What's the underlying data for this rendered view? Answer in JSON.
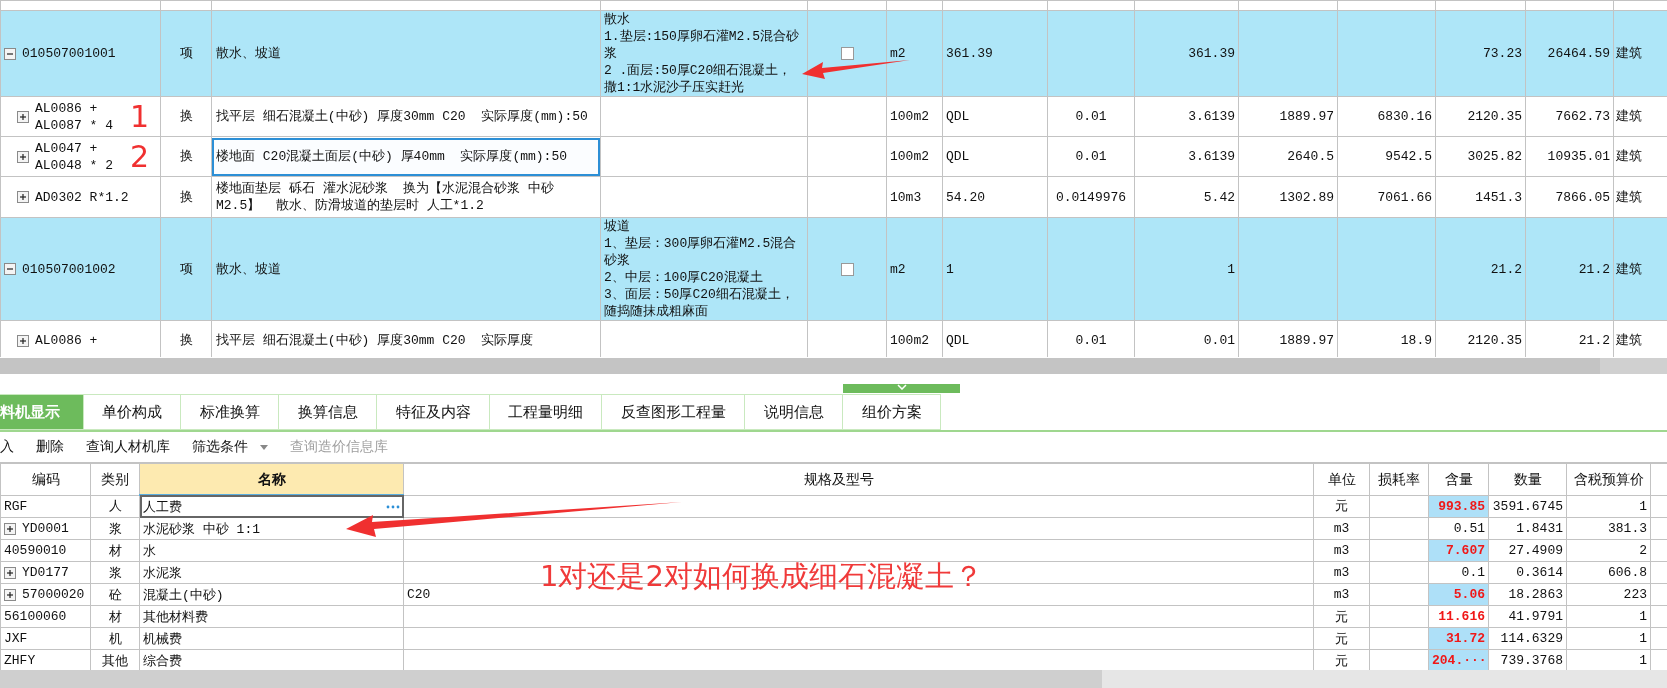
{
  "upper_table": {
    "rows": [
      {
        "kind": "item",
        "expanded": true,
        "selected": false,
        "checked": false,
        "code": "010507001001",
        "type": "项",
        "name": "散水、坡道",
        "features": "散水\n1.垫层:150厚卵石灌M2.5混合砂浆\n2 .面层:50厚C20细石混凝土，撒1:1水泥沙子压实赶光",
        "column_6": "m2",
        "column_7": "361.39",
        "column_9": "361.39",
        "column_12": "73.23",
        "column_13": "26464.59",
        "column_14": "建筑"
      },
      {
        "kind": "sub",
        "expanded": false,
        "selected": false,
        "code": "AL0086 +\nAL0087 * 4",
        "type": "换",
        "name": "找平层 细石混凝土(中砂) 厚度30mm C20  实际厚度(mm):50",
        "column_6": "100m2",
        "column_7": "QDL",
        "column_8": "0.01",
        "column_9": "3.6139",
        "column_10": "1889.97",
        "column_11": "6830.16",
        "column_12": "2120.35",
        "column_13": "7662.73",
        "column_14": "建筑"
      },
      {
        "kind": "sub",
        "expanded": false,
        "selected": true,
        "code": "AL0047 +\nAL0048 * 2",
        "type": "换",
        "name": "楼地面 C20混凝土面层(中砂) 厚40mm  实际厚度(mm):50",
        "column_6": "100m2",
        "column_7": "QDL",
        "column_8": "0.01",
        "column_9": "3.6139",
        "column_10": "2640.5",
        "column_11": "9542.5",
        "column_12": "3025.82",
        "column_13": "10935.01",
        "column_14": "建筑"
      },
      {
        "kind": "sub",
        "expanded": false,
        "selected": false,
        "code": "AD0302 R*1.2",
        "type": "换",
        "name": "楼地面垫层 砾石 灌水泥砂浆  换为【水泥混合砂浆 中砂 M2.5】  散水、防滑坡道的垫层时 人工*1.2",
        "column_6": "10m3",
        "column_7": "54.20",
        "column_8": "0.0149976",
        "column_9": "5.42",
        "column_10": "1302.89",
        "column_11": "7061.66",
        "column_12": "1451.3",
        "column_13": "7866.05",
        "column_14": "建筑"
      },
      {
        "kind": "item",
        "expanded": true,
        "selected": false,
        "checked": false,
        "code": "010507001002",
        "type": "项",
        "name": "散水、坡道",
        "features": "坡道\n1、垫层：300厚卵石灌M2.5混合砂浆\n2、中层：100厚C20混凝土\n3、面层：50厚C20细石混凝土，随捣随抹成粗麻面",
        "column_6": "m2",
        "column_7": "1",
        "column_9": "1",
        "column_12": "21.2",
        "column_13": "21.2",
        "column_14": "建筑"
      },
      {
        "kind": "sub",
        "expanded": false,
        "selected": false,
        "code": "AL0086 +",
        "type": "换",
        "name": "找平层 细石混凝土(中砂) 厚度30mm C20  实际厚度",
        "column_6": "100m2",
        "column_7": "QDL",
        "column_8": "0.01",
        "column_9": "0.01",
        "column_10": "1889.97",
        "column_11": "18.9",
        "column_12": "2120.35",
        "column_13": "21.2",
        "column_14": "建筑"
      }
    ]
  },
  "detail_tabs": [
    {
      "label": "料机显示",
      "selected": true
    },
    {
      "label": "单价构成",
      "selected": false
    },
    {
      "label": "标准换算",
      "selected": false
    },
    {
      "label": "换算信息",
      "selected": false
    },
    {
      "label": "特征及内容",
      "selected": false
    },
    {
      "label": "工程量明细",
      "selected": false
    },
    {
      "label": "反查图形工程量",
      "selected": false
    },
    {
      "label": "说明信息",
      "selected": false
    },
    {
      "label": "组价方案",
      "selected": false
    }
  ],
  "toolbar": [
    {
      "kind": "button",
      "label": "入",
      "disabled": false
    },
    {
      "kind": "button",
      "label": "删除",
      "disabled": false
    },
    {
      "kind": "button",
      "label": "查询人材机库",
      "disabled": false
    },
    {
      "kind": "dropdown",
      "label": "筛选条件",
      "disabled": false
    },
    {
      "kind": "button",
      "label": "查询造价信息库",
      "disabled": true
    }
  ],
  "material_table": {
    "columns": [
      {
        "label": "编码",
        "selected": false
      },
      {
        "label": "类别",
        "selected": false
      },
      {
        "label": "名称",
        "selected": true
      },
      {
        "label": "规格及型号",
        "selected": false
      },
      {
        "label": "单位",
        "selected": false
      },
      {
        "label": "损耗率",
        "selected": false
      },
      {
        "label": "含量",
        "selected": false
      },
      {
        "label": "数量",
        "selected": false
      },
      {
        "label": "含税预算价",
        "selected": false
      }
    ],
    "rows": [
      {
        "kind": "leaf",
        "selected": true,
        "code": "RGF",
        "type": "人",
        "name": "人工费",
        "unit": "元",
        "amount": "993.85",
        "modified": true,
        "highlighted": true,
        "quantity": "3591.6745",
        "price": "1"
      },
      {
        "kind": "group",
        "expanded": false,
        "selected": false,
        "code": "YD0001",
        "type": "浆",
        "name": "水泥砂浆 中砂 1:1",
        "unit": "m3",
        "amount": "0.51",
        "modified": false,
        "highlighted": false,
        "quantity": "1.8431",
        "price": "381.3"
      },
      {
        "kind": "leaf",
        "selected": false,
        "code": "40590010",
        "type": "材",
        "name": "水",
        "unit": "m3",
        "amount": "7.607",
        "modified": true,
        "highlighted": true,
        "quantity": "27.4909",
        "price": "2"
      },
      {
        "kind": "group",
        "expanded": false,
        "selected": false,
        "code": "YD0177",
        "type": "浆",
        "name": "水泥浆",
        "unit": "m3",
        "amount": "0.1",
        "modified": false,
        "highlighted": false,
        "quantity": "0.3614",
        "price": "606.8"
      },
      {
        "kind": "group",
        "expanded": false,
        "selected": false,
        "code": "57000020",
        "type": "砼",
        "name": "混凝土(中砂)",
        "spec": "C20",
        "unit": "m3",
        "amount": "5.06",
        "modified": true,
        "highlighted": true,
        "quantity": "18.2863",
        "price": "223"
      },
      {
        "kind": "leaf",
        "selected": false,
        "code": "56100060",
        "type": "材",
        "name": "其他材料费",
        "unit": "元",
        "amount": "11.616",
        "modified": true,
        "highlighted": false,
        "quantity": "41.9791",
        "price": "1"
      },
      {
        "kind": "leaf",
        "selected": false,
        "code": "JXF",
        "type": "机",
        "name": "机械费",
        "unit": "元",
        "amount": "31.72",
        "modified": true,
        "highlighted": true,
        "quantity": "114.6329",
        "price": "1"
      },
      {
        "kind": "leaf",
        "selected": false,
        "code": "ZHFY",
        "type": "其他",
        "name": "综合费",
        "unit": "元",
        "amount": "204.···",
        "modified": true,
        "highlighted": true,
        "quantity": "739.3768",
        "price": "1"
      }
    ]
  },
  "annotations": {
    "markers": [
      "1",
      "2"
    ],
    "question": "1对还是2对如何换成细石混凝土？"
  }
}
